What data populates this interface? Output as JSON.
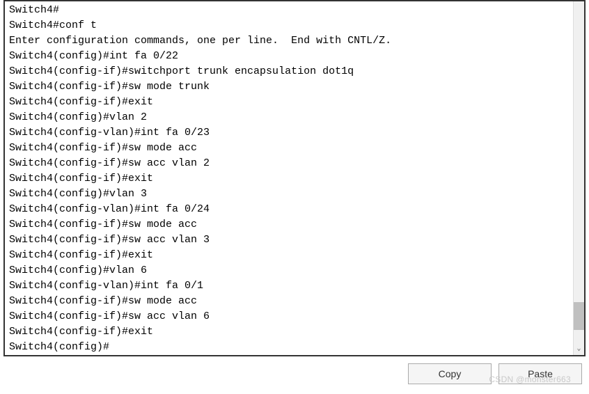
{
  "terminal": {
    "lines": [
      "Switch4#",
      "Switch4#conf t",
      "Enter configuration commands, one per line.  End with CNTL/Z.",
      "Switch4(config)#int fa 0/22",
      "Switch4(config-if)#switchport trunk encapsulation dot1q",
      "Switch4(config-if)#sw mode trunk",
      "Switch4(config-if)#exit",
      "Switch4(config)#vlan 2",
      "Switch4(config-vlan)#int fa 0/23",
      "Switch4(config-if)#sw mode acc",
      "Switch4(config-if)#sw acc vlan 2",
      "Switch4(config-if)#exit",
      "Switch4(config)#vlan 3",
      "Switch4(config-vlan)#int fa 0/24",
      "Switch4(config-if)#sw mode acc",
      "Switch4(config-if)#sw acc vlan 3",
      "Switch4(config-if)#exit",
      "Switch4(config)#vlan 6",
      "Switch4(config-vlan)#int fa 0/1",
      "Switch4(config-if)#sw mode acc",
      "Switch4(config-if)#sw acc vlan 6",
      "Switch4(config-if)#exit",
      "Switch4(config)#"
    ]
  },
  "buttons": {
    "copy": "Copy",
    "paste": "Paste"
  },
  "watermark": "CSDN @monster663",
  "scroll": {
    "down_arrow": "⌄"
  }
}
